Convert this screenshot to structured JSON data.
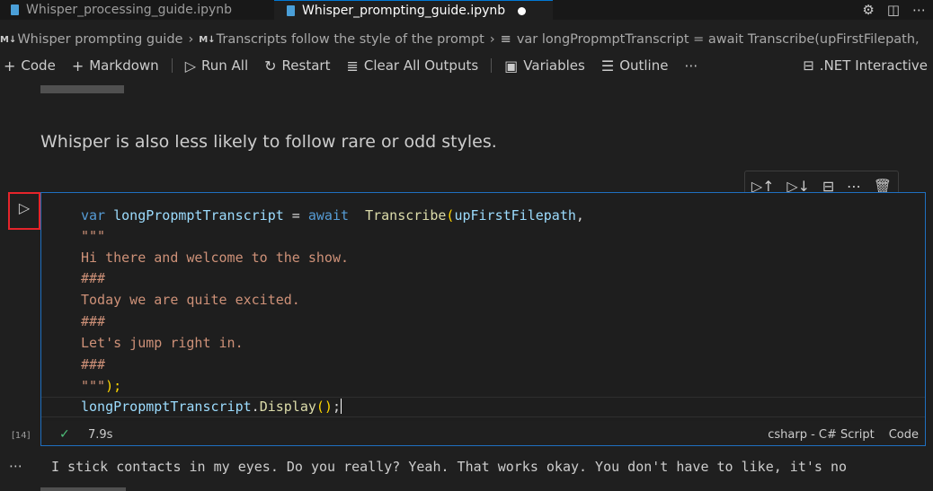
{
  "tabs": [
    {
      "label": "Whisper_processing_guide.ipynb",
      "active": false
    },
    {
      "label": "Whisper_prompting_guide.ipynb",
      "active": true,
      "dirty": true
    }
  ],
  "breadcrumb": {
    "notebook": "Whisper prompting guide",
    "section": "Transcripts follow the style of the prompt",
    "symbol": "var longPropmptTranscript = await  Transcribe(upFirstFilepath,"
  },
  "toolbar": {
    "code": "Code",
    "markdown": "Markdown",
    "run_all": "Run All",
    "restart": "Restart",
    "clear_outputs": "Clear All Outputs",
    "variables": "Variables",
    "outline": "Outline",
    "kernel": ".NET Interactive"
  },
  "markdown_text": "Whisper is also less likely to follow rare or odd styles.",
  "code": {
    "line1": {
      "kw": "var",
      "name": "longPropmptTranscript",
      "eq": " = ",
      "await": "await",
      "fn": "Transcribe",
      "arg": "upFirstFilepath",
      "tail": ","
    },
    "line2": "\"\"\"",
    "line3": "Hi there and welcome to the show.",
    "line4": "###",
    "line5": "Today we are quite excited.",
    "line6": "###",
    "line7": "Let's jump right in.",
    "line8": "###",
    "line9": {
      "str": "\"\"\"",
      "tail": ");"
    },
    "line10": {
      "name": "longPropmptTranscript",
      "dot": ".",
      "fn": "Display",
      "tail": ";"
    }
  },
  "cell_status": {
    "execution_count": "[14]",
    "duration": "7.9s",
    "language": "csharp - C# Script",
    "cell_kind": "Code"
  },
  "output_text": "I stick contacts in my eyes. Do you really? Yeah. That works okay. You don't have to like, it's no",
  "colors": {
    "accent": "#0078d4",
    "run_highlight": "#e5242b",
    "success": "#4ec07a"
  }
}
